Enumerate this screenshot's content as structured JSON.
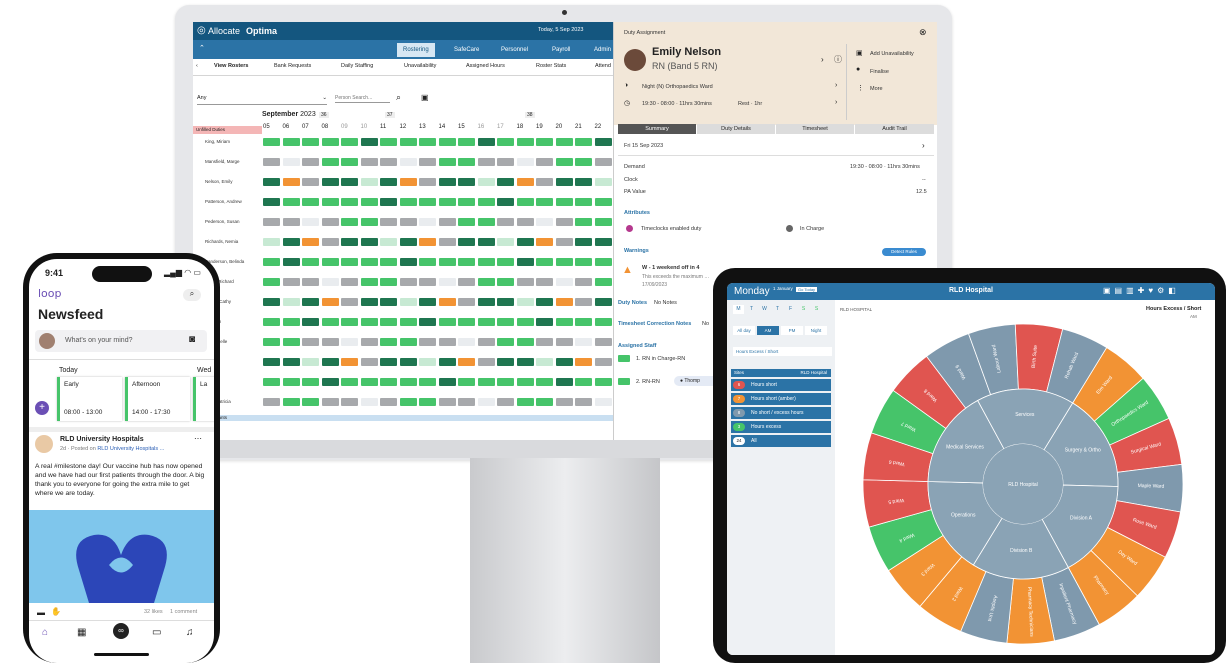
{
  "optima": {
    "brand": "Allocate",
    "brand_bold": "Optima",
    "today": "Today, 5 Sep 2023",
    "nav_tabs": [
      "Rostering",
      "SafeCare",
      "Personnel",
      "Payroll",
      "Admin"
    ],
    "subnav": [
      "View Rosters",
      "Bank Requests",
      "Daily Staffing",
      "Unavailability",
      "Assigned Hours",
      "Roster Stats",
      "Attend"
    ],
    "filter_value": "Any",
    "search_placeholder": "Person Search...",
    "month": "September",
    "year": "2023",
    "week_labels": [
      "36",
      "37",
      "38"
    ],
    "days": [
      "05",
      "06",
      "07",
      "08",
      "09",
      "10",
      "11",
      "12",
      "13",
      "14",
      "15",
      "16",
      "17",
      "18",
      "19",
      "20",
      "21",
      "22"
    ],
    "unfilled": "Unfilled Duties",
    "staff": [
      "King, Miriam",
      "Mansfield, Marge",
      "Nelson, Emily",
      "Patterson, Andrew",
      "Pederson, Susan",
      "Richards, Nemia",
      "Sanderson, Belinda",
      "…mo, Richard",
      "…son, Cathy",
      "…Helen",
      "… Michelle",
      "…e",
      "…ob",
      "…rs, Patricia"
    ],
    "assistants_label": "…ssistants"
  },
  "duty": {
    "title": "Duty Assignment",
    "name": "Emily Nelson",
    "grade": "RN (Band 5 RN)",
    "shift": "Night (N) Orthopaedics Ward",
    "time": "19:30 - 08:00 · 11hrs 30mins",
    "rest": "Rest · 1hr",
    "actions": [
      "Add Unavailability",
      "Finalise",
      "More"
    ],
    "tabs": [
      "Summary",
      "Duty Details",
      "Timesheet",
      "Audit Trail"
    ],
    "date": "Fri 15 Sep 2023",
    "demand_label": "Demand",
    "demand_value": "19:30 - 08:00 · 11hrs 30mins",
    "clock_label": "Clock",
    "clock_value": "--",
    "pa_label": "PA Value",
    "pa_value": "12.5",
    "attributes_label": "Attributes",
    "attr1": "Timeclocks enabled duty",
    "attr2": "In Charge",
    "warnings_label": "Warnings",
    "rules_btn": "Detect Rules",
    "warn_title": "W - 1 weekend off in 4",
    "warn_text": "This exceeds the maximum …",
    "warn_date": "17/09/2023",
    "duty_notes_label": "Duty Notes",
    "duty_notes_value": "No Notes",
    "ts_notes_label": "Timesheet Correction Notes",
    "ts_notes_value": "No",
    "assigned_label": "Assigned Staff",
    "assigned": [
      "1. RN in Charge-RN",
      "2. RN-RN"
    ],
    "assigned_person": "Thomp"
  },
  "phone": {
    "time": "9:41",
    "app": "loop",
    "title": "Newsfeed",
    "prompt": "What's on your mind?",
    "days": [
      "Today",
      "Wed"
    ],
    "shifts": [
      {
        "label": "Early",
        "time": "08:00 - 13:00"
      },
      {
        "label": "Afternoon",
        "time": "14:00 - 17:30"
      },
      {
        "label": "La",
        "time": ""
      }
    ],
    "post_author": "RLD University Hospitals",
    "post_meta": "2d · Posted on",
    "post_meta_link": "RLD University Hospitals ...",
    "post_text": "A real #milestone day! Our vaccine hub has now opened and we have had our first patients through the door. A big thank you to everyone for going the extra mile to get where we are today.",
    "likes": "32 likes",
    "comments": "1 comment"
  },
  "tablet": {
    "day": "Monday",
    "date_small": "1 January",
    "today_btn": "Go Today",
    "title": "RLD Hospital",
    "weekdays": [
      "M",
      "T",
      "W",
      "T",
      "F",
      "S",
      "S"
    ],
    "periods": [
      "All day",
      "AM",
      "PM",
      "Night"
    ],
    "filter": "Hours Excess / Short",
    "sites_label": "Sites",
    "site_name": "RLD Hospital",
    "status": [
      {
        "count": "6",
        "label": "Hours short",
        "color": "#e05550"
      },
      {
        "count": "7",
        "label": "Hours short (amber)",
        "color": "#f29334"
      },
      {
        "count": "8",
        "label": "No short / excess hours",
        "color": "#7f99ad"
      },
      {
        "count": "3",
        "label": "Hours excess",
        "color": "#46c46a"
      },
      {
        "count": "24",
        "label": "All",
        "color": "#ffffff"
      }
    ],
    "breadcrumb": "RLD HOSPITAL",
    "right_title": "Hours Excess / Short",
    "right_sub": "AM",
    "center": "RLD Hospital",
    "divisions": [
      "Surgery & Ortho",
      "Division A",
      "Division B",
      "Operations",
      "Medical Services",
      "Services"
    ],
    "wards": [
      "Elm Ward",
      "Orthopaedics Ward",
      "Surgical Ward",
      "Maple Ward",
      "Rose Ward",
      "Day Ward",
      "Pharmacy",
      "Inpatient Pharmacy",
      "Pharmacy Technicians",
      "Aseptic Unit",
      "Ward 2",
      "Ward 3",
      "Ward 4",
      "Ward 5",
      "Ward 6",
      "Ward 7",
      "Ward 8",
      "Ward 9",
      "Labour Ward",
      "Birth Suite",
      "Rehab Ward"
    ]
  }
}
